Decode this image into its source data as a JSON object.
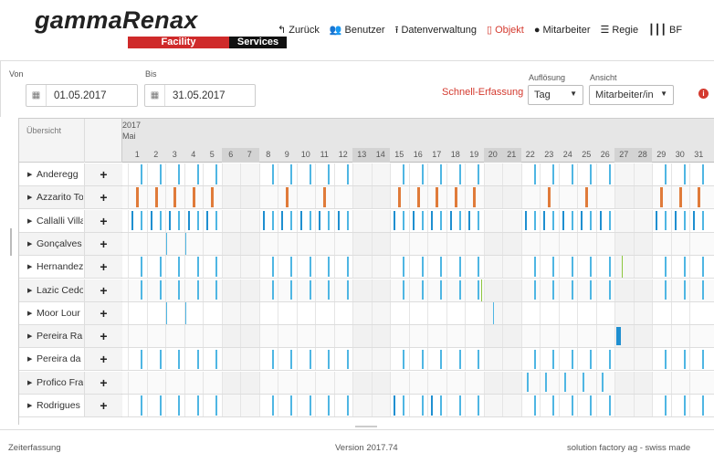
{
  "brand": {
    "name": "gammaRenax",
    "tag_facility": "Facility",
    "tag_services": "Services"
  },
  "nav": [
    {
      "label": "Zurück",
      "icon": "back-arrow-icon",
      "glyph": "↰",
      "active": false
    },
    {
      "label": "Benutzer",
      "icon": "users-icon",
      "glyph": "👥",
      "active": false
    },
    {
      "label": "Datenverwaltung",
      "icon": "upload-icon",
      "glyph": "⭱",
      "active": false
    },
    {
      "label": "Objekt",
      "icon": "building-icon",
      "glyph": "▯",
      "active": true
    },
    {
      "label": "Mitarbeiter",
      "icon": "user-icon",
      "glyph": "●",
      "active": false
    },
    {
      "label": "Regie",
      "icon": "list-icon",
      "glyph": "☰",
      "active": false
    },
    {
      "label": "BF",
      "icon": "barcode-icon",
      "glyph": "┃┃┃",
      "active": false
    }
  ],
  "filters": {
    "from_label": "Von",
    "from_value": "01.05.2017",
    "to_label": "Bis",
    "to_value": "31.05.2017",
    "quick_entry": "Schnell-Erfassung",
    "resolution_label": "Auflösung",
    "resolution_value": "Tag",
    "view_label": "Ansicht",
    "view_value": "Mitarbeiter/in"
  },
  "grid": {
    "overview_label": "Übersicht",
    "year": "2017",
    "month": "Mai",
    "days": [
      "1",
      "2",
      "3",
      "4",
      "5",
      "6",
      "7",
      "8",
      "9",
      "10",
      "11",
      "12",
      "13",
      "14",
      "15",
      "16",
      "17",
      "18",
      "19",
      "20",
      "21",
      "22",
      "23",
      "24",
      "25",
      "26",
      "27",
      "28",
      "29",
      "30",
      "31"
    ],
    "weekend_days": [
      6,
      7,
      13,
      14,
      20,
      21,
      27,
      28
    ],
    "add_glyph": "+",
    "rows": [
      {
        "name": "Anderegg",
        "segments": []
      },
      {
        "name": "Azzarito To",
        "segments": []
      },
      {
        "name": "Callalli Villa",
        "segments": []
      },
      {
        "name": "Gonçalves",
        "segments": []
      },
      {
        "name": "Hernandez",
        "segments": []
      },
      {
        "name": "Lazic Cedo",
        "segments": []
      },
      {
        "name": "Moor Lour",
        "segments": []
      },
      {
        "name": "Pereira Ra",
        "segments": []
      },
      {
        "name": "Pereira da",
        "segments": []
      },
      {
        "name": "Profico Fra",
        "segments": []
      },
      {
        "name": "Rodrigues",
        "segments": []
      }
    ],
    "colors": {
      "blue": "#4fb6e3",
      "dark_blue": "#1f8fd0",
      "orange": "#e07b3a",
      "green": "#8cc63e"
    }
  },
  "footer": {
    "left": "Zeiterfassung",
    "center": "Version 2017.74",
    "right": "solution factory ag - swiss made"
  }
}
